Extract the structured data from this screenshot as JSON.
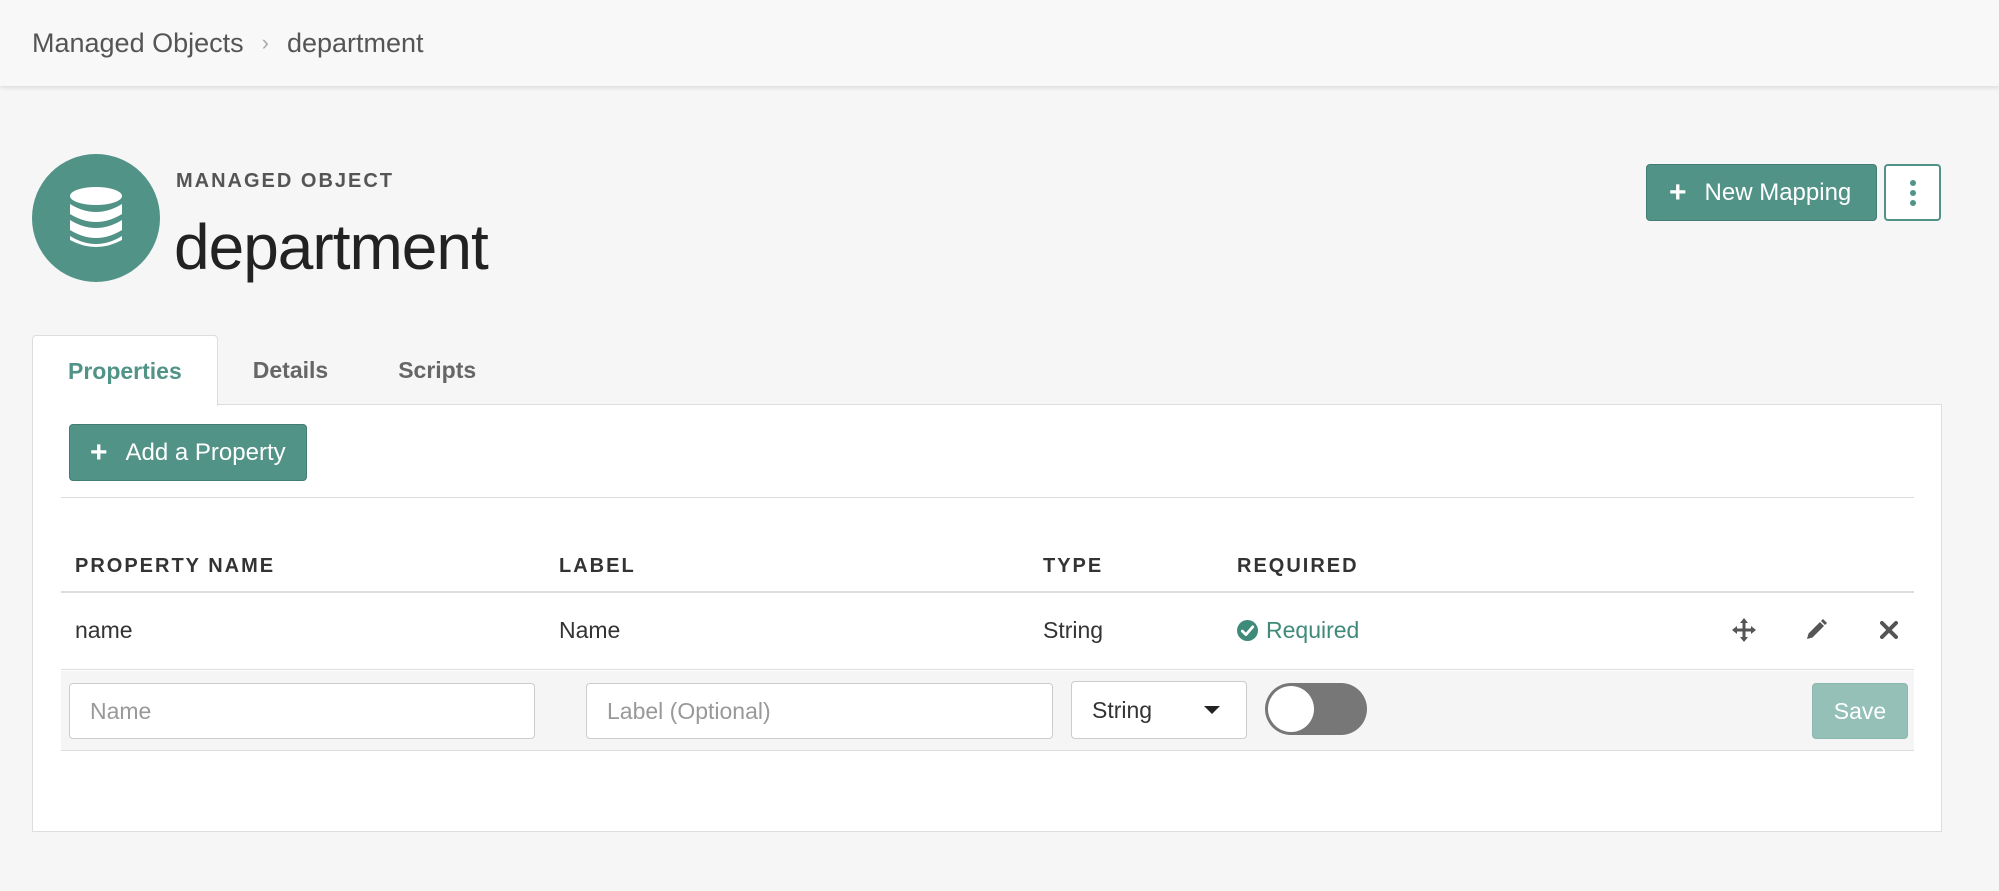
{
  "breadcrumb": {
    "root": "Managed Objects",
    "current": "department"
  },
  "header": {
    "eyebrow": "MANAGED OBJECT",
    "title": "department",
    "icon": "database-icon"
  },
  "actions": {
    "new_mapping_label": "New Mapping"
  },
  "tabs": [
    {
      "label": "Properties",
      "active": true
    },
    {
      "label": "Details",
      "active": false
    },
    {
      "label": "Scripts",
      "active": false
    }
  ],
  "properties": {
    "add_label": "Add a Property",
    "columns": [
      "PROPERTY NAME",
      "LABEL",
      "TYPE",
      "REQUIRED"
    ],
    "rows": [
      {
        "name": "name",
        "label": "Name",
        "type": "String",
        "required": "Required"
      }
    ],
    "new_row": {
      "name_placeholder": "Name",
      "label_placeholder": "Label (Optional)",
      "type_value": "String",
      "required_toggle": false,
      "save_label": "Save"
    }
  },
  "colors": {
    "accent": "#519387",
    "required": "#3f8a79"
  }
}
